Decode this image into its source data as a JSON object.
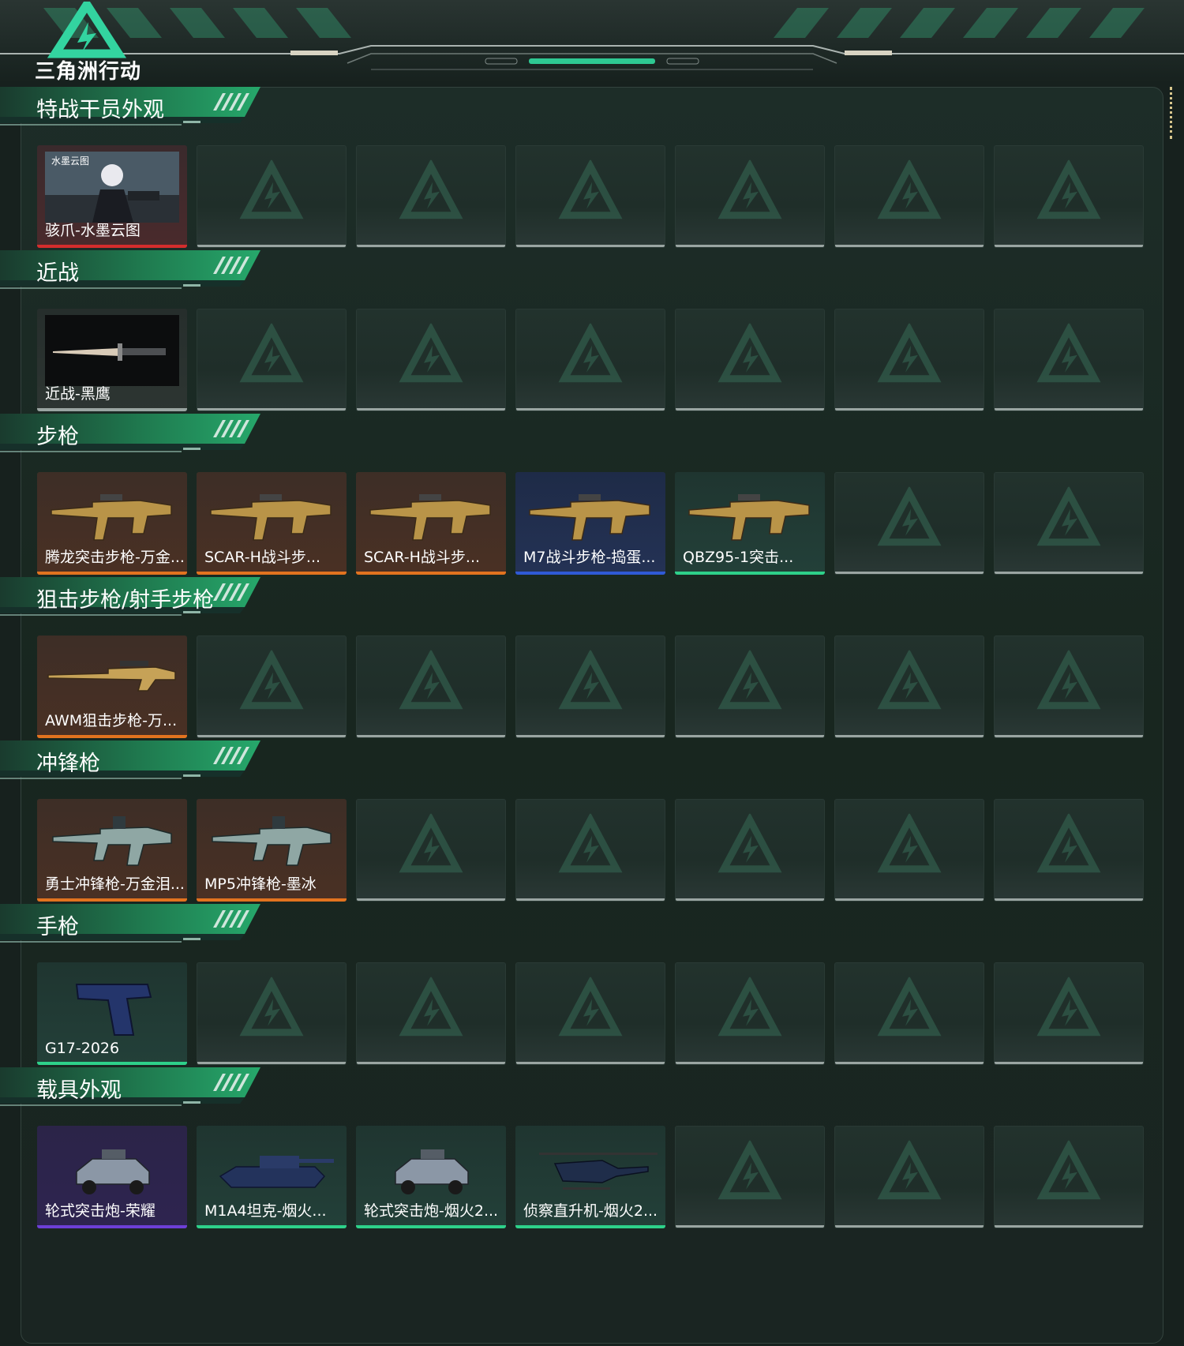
{
  "app": {
    "title": "三角洲行动"
  },
  "colors": {
    "red": "#d42d2d",
    "orange": "#e2731f",
    "blue": "#2f5ad6",
    "green": "#2ed18a",
    "purple": "#6d3fd6",
    "empty": "#9aa5a2"
  },
  "sections": [
    {
      "title": "特战干员外观",
      "items": [
        {
          "name": "骇爪-水墨云图",
          "rarity": "red",
          "icon": "operator-skin-icon"
        }
      ],
      "empty_slots": 6
    },
    {
      "title": "近战",
      "items": [
        {
          "name": "近战-黑鹰",
          "rarity": "gray",
          "icon": "knife-icon"
        }
      ],
      "empty_slots": 6
    },
    {
      "title": "步枪",
      "items": [
        {
          "name": "腾龙突击步枪-万金...",
          "rarity": "orange",
          "icon": "rifle-icon"
        },
        {
          "name": "SCAR-H战斗步...",
          "rarity": "orange",
          "icon": "rifle-icon"
        },
        {
          "name": "SCAR-H战斗步...",
          "rarity": "orange",
          "icon": "rifle-icon"
        },
        {
          "name": "M7战斗步枪-捣蛋...",
          "rarity": "blue",
          "icon": "rifle-icon"
        },
        {
          "name": "QBZ95-1突击...",
          "rarity": "green",
          "icon": "rifle-icon"
        }
      ],
      "empty_slots": 2
    },
    {
      "title": "狙击步枪/射手步枪",
      "items": [
        {
          "name": "AWM狙击步枪-万...",
          "rarity": "orange",
          "icon": "sniper-rifle-icon"
        }
      ],
      "empty_slots": 6
    },
    {
      "title": "冲锋枪",
      "items": [
        {
          "name": "勇士冲锋枪-万金泪...",
          "rarity": "orange",
          "icon": "smg-icon"
        },
        {
          "name": "MP5冲锋枪-墨冰",
          "rarity": "orange",
          "icon": "smg-icon"
        }
      ],
      "empty_slots": 5
    },
    {
      "title": "手枪",
      "items": [
        {
          "name": "G17-2026",
          "rarity": "green",
          "icon": "pistol-icon"
        }
      ],
      "empty_slots": 6
    },
    {
      "title": "载具外观",
      "items": [
        {
          "name": "轮式突击炮-荣耀",
          "rarity": "purple",
          "icon": "armored-car-icon"
        },
        {
          "name": "M1A4坦克-烟火...",
          "rarity": "green",
          "icon": "tank-icon"
        },
        {
          "name": "轮式突击炮-烟火2...",
          "rarity": "green",
          "icon": "armored-car-icon"
        },
        {
          "name": "侦察直升机-烟火2...",
          "rarity": "green",
          "icon": "helicopter-icon"
        }
      ],
      "empty_slots": 3
    }
  ]
}
